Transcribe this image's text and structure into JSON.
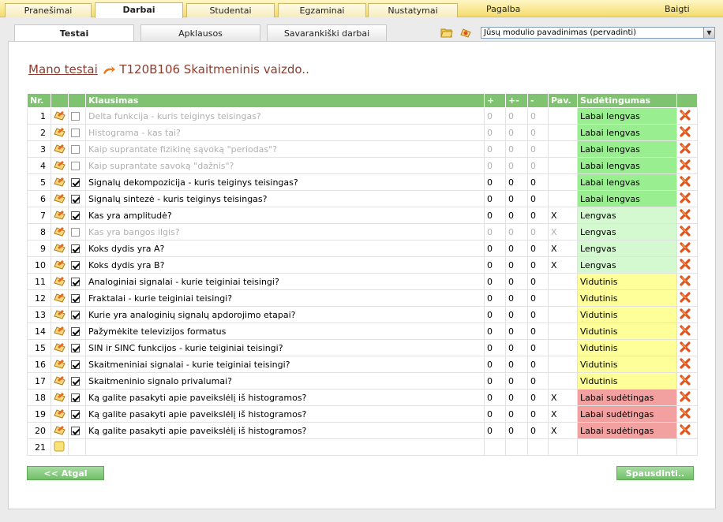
{
  "topnav": {
    "tabs": [
      "Pranešimai",
      "Darbai",
      "Studentai",
      "Egzaminai",
      "Nustatymai"
    ],
    "help": "Pagalba",
    "logout": "Baigti"
  },
  "subtabs": [
    "Testai",
    "Apklausos",
    "Savarankiški darbai"
  ],
  "module_select": {
    "value": "Jūsų modulio pavadinimas (pervadinti)"
  },
  "breadcrumb": {
    "link": "Mano testai",
    "current": "T120B106 Skaitmeninis vaizdo.."
  },
  "table": {
    "headers": {
      "nr": "Nr.",
      "question": "Klausimas",
      "plus": "+",
      "plusminus": "+-",
      "minus": "-",
      "pic": "Pav.",
      "difficulty": "Sudėtingumas"
    },
    "rows": [
      {
        "nr": "1",
        "checked": false,
        "text": "Delta funkcija - kuris teiginys teisingas?",
        "p": "0",
        "pm": "0",
        "m": "0",
        "pav": "",
        "diff": "Labai lengvas"
      },
      {
        "nr": "2",
        "checked": false,
        "text": "Histograma - kas tai?",
        "p": "0",
        "pm": "0",
        "m": "0",
        "pav": "",
        "diff": "Labai lengvas"
      },
      {
        "nr": "3",
        "checked": false,
        "text": "Kaip suprantate fizikinę sąvoką \"periodas\"?",
        "p": "0",
        "pm": "0",
        "m": "0",
        "pav": "",
        "diff": "Labai lengvas"
      },
      {
        "nr": "4",
        "checked": false,
        "text": "Kaip suprantate savoką \"dažnis\"?",
        "p": "0",
        "pm": "0",
        "m": "0",
        "pav": "",
        "diff": "Labai lengvas"
      },
      {
        "nr": "5",
        "checked": true,
        "text": "Signalų dekompozicija - kuris teiginys teisingas?",
        "p": "0",
        "pm": "0",
        "m": "0",
        "pav": "",
        "diff": "Labai lengvas"
      },
      {
        "nr": "6",
        "checked": true,
        "text": "Signalų sintezė - kuris teiginys teisingas?",
        "p": "0",
        "pm": "0",
        "m": "0",
        "pav": "",
        "diff": "Labai lengvas"
      },
      {
        "nr": "7",
        "checked": true,
        "text": "Kas yra amplitudė?",
        "p": "0",
        "pm": "0",
        "m": "0",
        "pav": "X",
        "diff": "Lengvas"
      },
      {
        "nr": "8",
        "checked": false,
        "text": "Kas yra bangos ilgis?",
        "p": "0",
        "pm": "0",
        "m": "0",
        "pav": "X",
        "diff": "Lengvas"
      },
      {
        "nr": "9",
        "checked": true,
        "text": "Koks dydis yra A?",
        "p": "0",
        "pm": "0",
        "m": "0",
        "pav": "X",
        "diff": "Lengvas"
      },
      {
        "nr": "10",
        "checked": true,
        "text": "Koks dydis yra B?",
        "p": "0",
        "pm": "0",
        "m": "0",
        "pav": "X",
        "diff": "Lengvas"
      },
      {
        "nr": "11",
        "checked": true,
        "text": "Analoginiai signalai - kurie teiginiai teisingi?",
        "p": "0",
        "pm": "0",
        "m": "0",
        "pav": "",
        "diff": "Vidutinis"
      },
      {
        "nr": "12",
        "checked": true,
        "text": "Fraktalai - kurie teiginiai teisingi?",
        "p": "0",
        "pm": "0",
        "m": "0",
        "pav": "",
        "diff": "Vidutinis"
      },
      {
        "nr": "13",
        "checked": true,
        "text": "Kurie yra analoginių signalų apdorojimo etapai?",
        "p": "0",
        "pm": "0",
        "m": "0",
        "pav": "",
        "diff": "Vidutinis"
      },
      {
        "nr": "14",
        "checked": true,
        "text": "Pažymėkite televizijos formatus",
        "p": "0",
        "pm": "0",
        "m": "0",
        "pav": "",
        "diff": "Vidutinis"
      },
      {
        "nr": "15",
        "checked": true,
        "text": "SIN ir SINC funkcijos - kurie teiginiai teisingi?",
        "p": "0",
        "pm": "0",
        "m": "0",
        "pav": "",
        "diff": "Vidutinis"
      },
      {
        "nr": "16",
        "checked": true,
        "text": "Skaitmeniniai signalai - kurie teiginiai teisingi?",
        "p": "0",
        "pm": "0",
        "m": "0",
        "pav": "",
        "diff": "Vidutinis"
      },
      {
        "nr": "17",
        "checked": true,
        "text": "Skaitmeninio signalo privalumai?",
        "p": "0",
        "pm": "0",
        "m": "0",
        "pav": "",
        "diff": "Vidutinis"
      },
      {
        "nr": "18",
        "checked": true,
        "text": "Ką galite pasakyti apie paveikslėlį iš histogramos?",
        "p": "0",
        "pm": "0",
        "m": "0",
        "pav": "X",
        "diff": "Labai sudėtingas"
      },
      {
        "nr": "19",
        "checked": true,
        "text": "Ką galite pasakyti apie paveikslėlį iš histogramos?",
        "p": "0",
        "pm": "0",
        "m": "0",
        "pav": "X",
        "diff": "Labai sudėtingas"
      },
      {
        "nr": "20",
        "checked": true,
        "text": "Ką galite pasakyti apie paveikslėlį iš histogramos?",
        "p": "0",
        "pm": "0",
        "m": "0",
        "pav": "X",
        "diff": "Labai sudėtingas"
      }
    ],
    "new_row_nr": "21"
  },
  "buttons": {
    "back": "<< Atgal",
    "print": "Spausdinti.."
  },
  "colors": {
    "header_green": "#7fc370",
    "labai_lengvas": "#99ee8f",
    "lengvas": "#d4f8d0",
    "vidutinis": "#ffff99",
    "labai_sudetingas": "#f2a0a0"
  }
}
